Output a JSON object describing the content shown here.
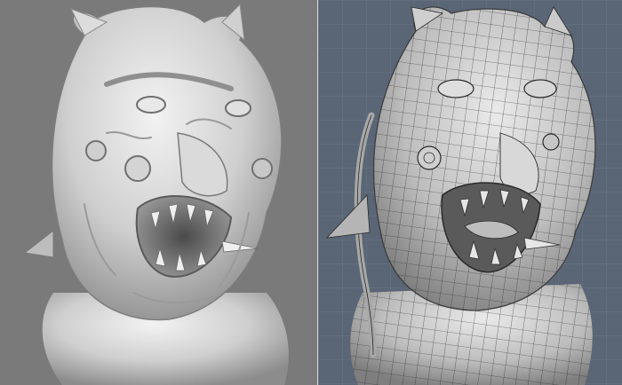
{
  "viewports": {
    "left": {
      "render_mode": "sculpt-shaded",
      "background_color": "#7a7a7a",
      "model_color": "#c8c8c8"
    },
    "right": {
      "render_mode": "wireframe-on-shaded",
      "background_color": "#5a6575",
      "grid_color": "#6a7585",
      "model_color": "#bdbdbd",
      "wire_color": "#2a2a2a"
    }
  }
}
